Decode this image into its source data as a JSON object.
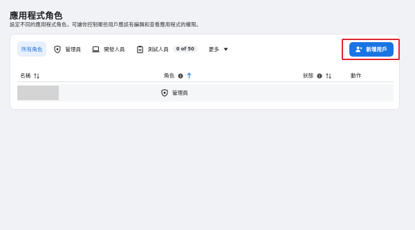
{
  "page": {
    "title": "應用程式角色",
    "subtitle": "設定不同的應用程式角色，可讓你控制哪些用戶應該有編輯和查看應用程式的權限。"
  },
  "tabs": [
    {
      "label": "所有角色",
      "icon": "none",
      "active": true
    },
    {
      "label": "管理員",
      "icon": "shield-icon"
    },
    {
      "label": "開發人員",
      "icon": "laptop-icon"
    },
    {
      "label": "測試人員",
      "icon": "clipboard-icon",
      "count": "0 of 50"
    },
    {
      "label": "更多",
      "icon": "caret-down-icon"
    }
  ],
  "add_user_button": {
    "label": "新增用戶",
    "icon": "add-person-icon"
  },
  "table": {
    "columns": {
      "name": "名稱",
      "role": "角色",
      "status": "狀態",
      "action": "動作"
    },
    "rows": [
      {
        "name": "",
        "role": "管理員",
        "status": "",
        "action": ""
      }
    ]
  },
  "colors": {
    "accent": "#1b74e4",
    "highlight_border": "#e0242d",
    "background": "#f0f2f5"
  }
}
